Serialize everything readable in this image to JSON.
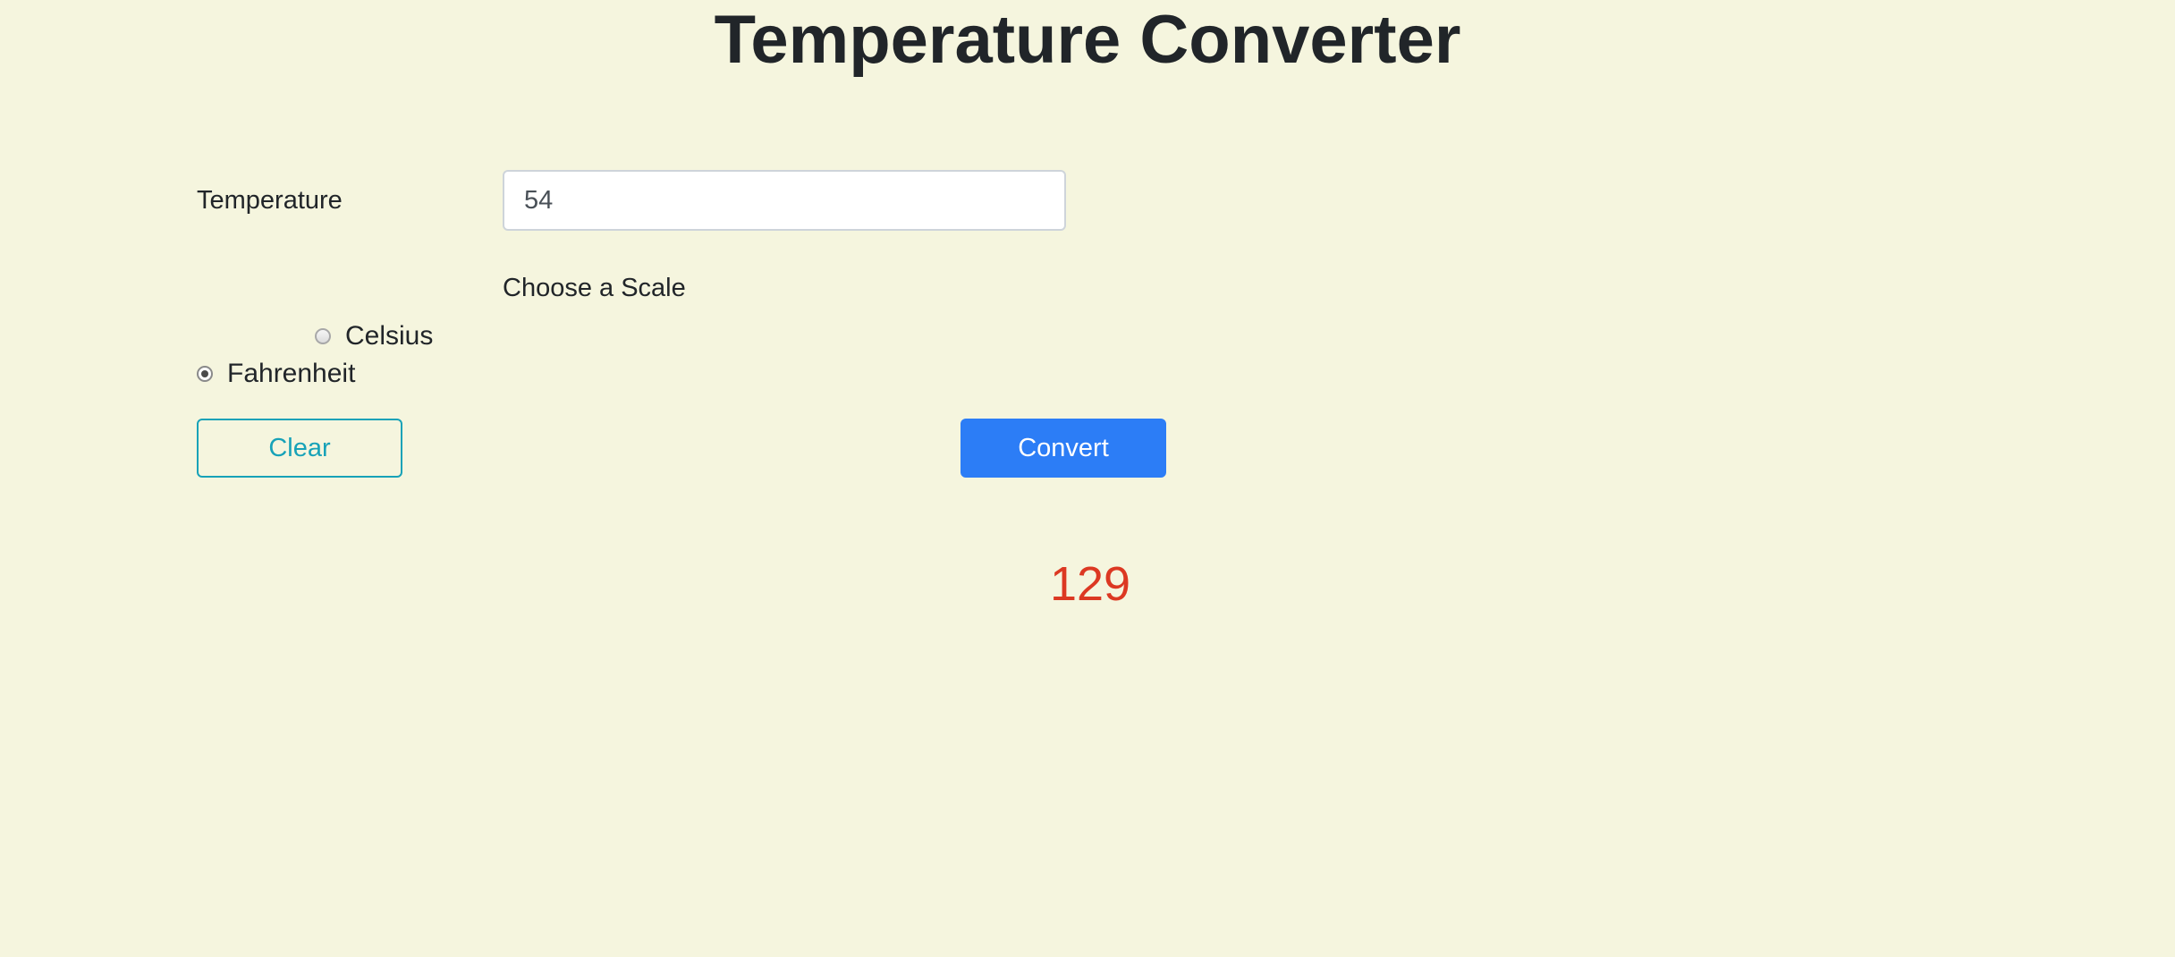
{
  "page": {
    "title": "Temperature Converter"
  },
  "form": {
    "temperature_label": "Temperature",
    "temperature_value": "54",
    "scale_heading": "Choose a Scale",
    "scales": [
      {
        "label": "Celsius",
        "checked": false
      },
      {
        "label": "Fahrenheit",
        "checked": true
      }
    ],
    "clear_label": "Clear",
    "convert_label": "Convert"
  },
  "result": {
    "value": "129"
  },
  "colors": {
    "background": "#f5f5de",
    "primary": "#2c7df6",
    "outline_info": "#17a2b8",
    "result": "#dc3822"
  }
}
